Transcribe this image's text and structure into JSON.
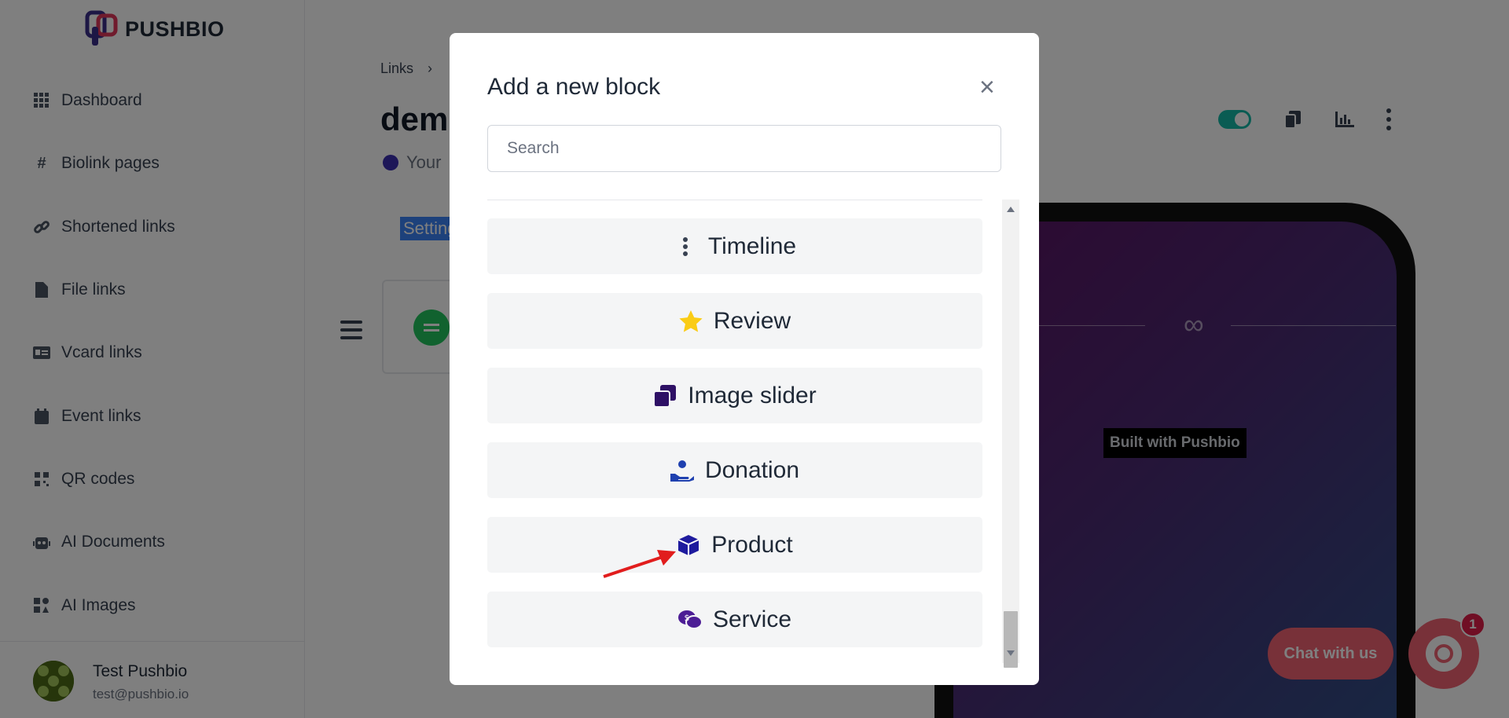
{
  "sidebar": {
    "logo_text": "PUSHBIO",
    "items": [
      {
        "label": "Dashboard",
        "icon": "grid-icon"
      },
      {
        "label": "Biolink pages",
        "icon": "hash-icon"
      },
      {
        "label": "Shortened links",
        "icon": "link-icon"
      },
      {
        "label": "File links",
        "icon": "file-icon"
      },
      {
        "label": "Vcard links",
        "icon": "id-card-icon"
      },
      {
        "label": "Event links",
        "icon": "calendar-icon"
      },
      {
        "label": "QR codes",
        "icon": "qr-code-icon"
      },
      {
        "label": "AI Documents",
        "icon": "robot-icon"
      },
      {
        "label": "AI Images",
        "icon": "ai-image-icon"
      }
    ],
    "user": {
      "name": "Test Pushbio",
      "email": "test@pushbio.io"
    }
  },
  "main": {
    "breadcrumb": [
      "Links",
      "›"
    ],
    "title": "demo",
    "subtitle": "Your",
    "tab": "Settings"
  },
  "preview": {
    "built_with": "Built with Pushbio"
  },
  "chat": {
    "label": "Chat with us",
    "badge": "1"
  },
  "modal": {
    "title": "Add a new block",
    "search_placeholder": "Search",
    "blocks": [
      {
        "label": "Timeline",
        "icon": "vertical-dots-icon",
        "color": "#374151"
      },
      {
        "label": "Review",
        "icon": "star-icon",
        "color": "#facc15"
      },
      {
        "label": "Image slider",
        "icon": "image-slider-icon",
        "color": "#2e1065"
      },
      {
        "label": "Donation",
        "icon": "donation-hand-icon",
        "color": "#1e40af"
      },
      {
        "label": "Product",
        "icon": "product-box-icon",
        "color": "#1e1b9e"
      },
      {
        "label": "Service",
        "icon": "service-chat-icon",
        "color": "#4c1d95"
      }
    ]
  },
  "colors": {
    "accent": "#3b82f6",
    "chat": "#f06272",
    "toggle": "#14b8a6"
  }
}
